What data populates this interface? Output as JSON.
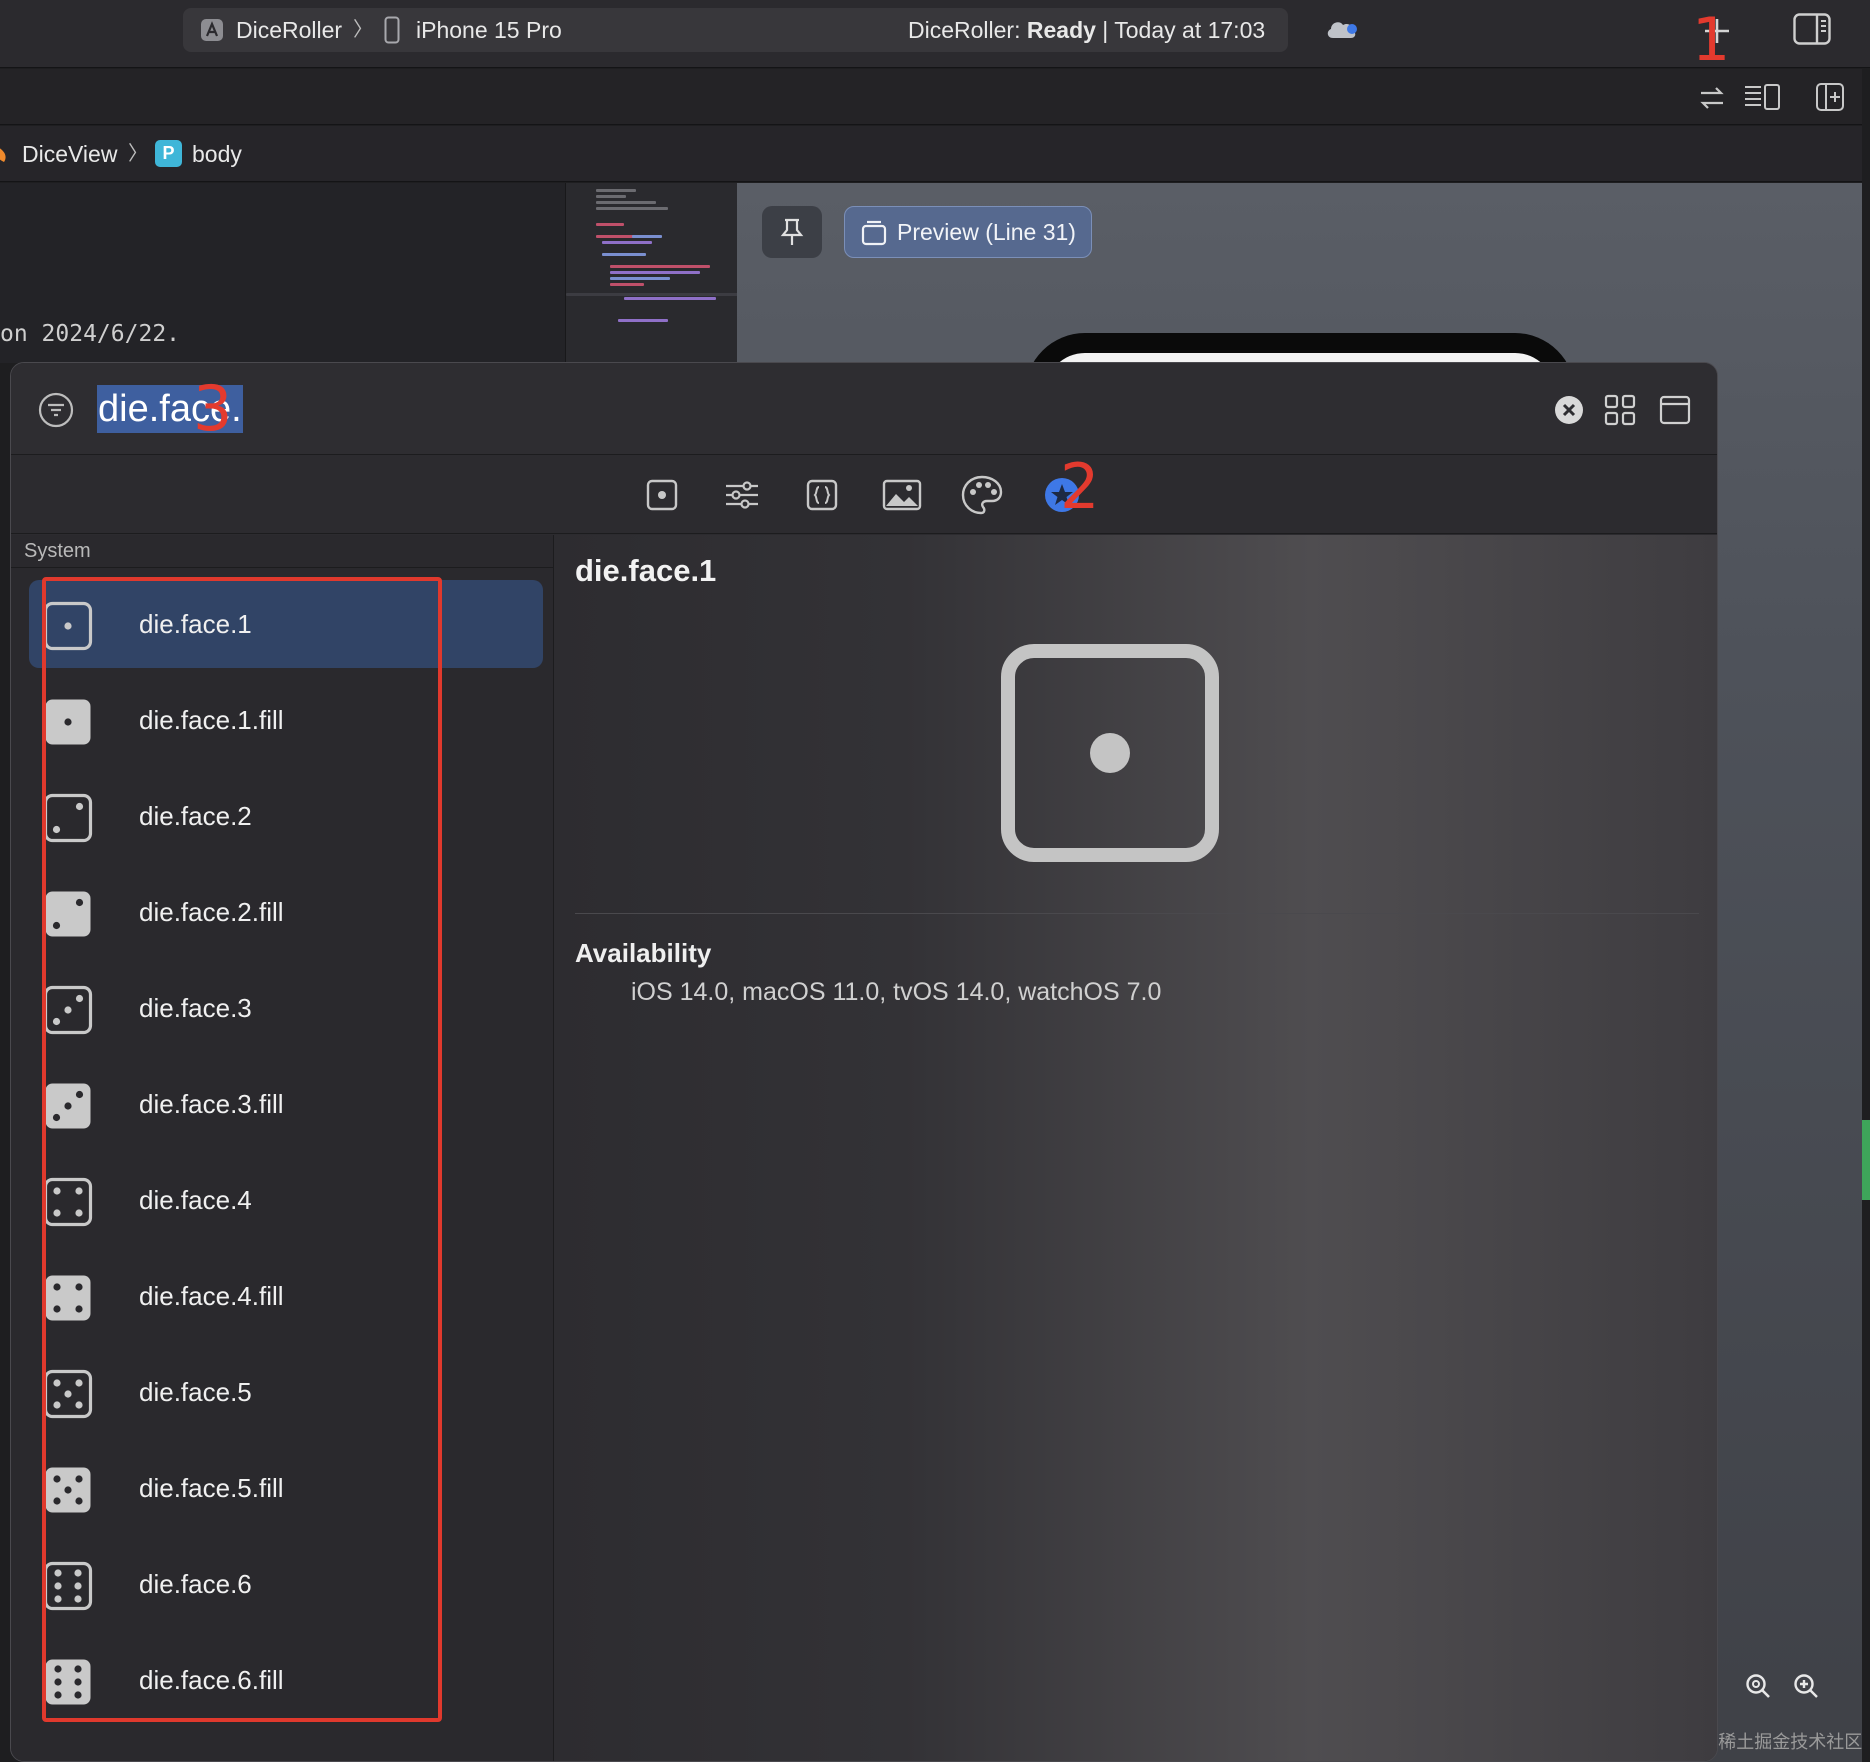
{
  "toolbar": {
    "project": "DiceRoller",
    "device": "iPhone 15 Pro",
    "status_prefix": "DiceRoller: ",
    "status_state": "Ready",
    "status_suffix": " | Today at 17:03",
    "icons": [
      "xcode-project-icon",
      "iphone-icon",
      "cloud-icon",
      "add-library-icon",
      "inspector-toggle-icon"
    ]
  },
  "editor": {
    "icons": [
      "switch-editor-icon",
      "editor-options-icon",
      "add-editor-icon"
    ],
    "breadcrumb": {
      "file": "DiceView",
      "badge": "P",
      "symbol": "body"
    },
    "code_line": "on 2024/6/22."
  },
  "preview": {
    "button_label": "Preview (Line 31)",
    "zoom_icons": [
      "zoom-out-icon",
      "zoom-in-icon"
    ]
  },
  "library": {
    "search_value": "die.face.",
    "header_icons": [
      "filter-icon",
      "clear-search-icon",
      "grid-view-icon",
      "detail-view-icon"
    ],
    "categories": [
      "views",
      "modifiers",
      "snippets",
      "media",
      "colors",
      "symbols"
    ],
    "selected_category": "symbols",
    "section": "System",
    "symbols": [
      {
        "name": "die.face.1",
        "pips": 1,
        "fill": false
      },
      {
        "name": "die.face.1.fill",
        "pips": 1,
        "fill": true
      },
      {
        "name": "die.face.2",
        "pips": 2,
        "fill": false
      },
      {
        "name": "die.face.2.fill",
        "pips": 2,
        "fill": true
      },
      {
        "name": "die.face.3",
        "pips": 3,
        "fill": false
      },
      {
        "name": "die.face.3.fill",
        "pips": 3,
        "fill": true
      },
      {
        "name": "die.face.4",
        "pips": 4,
        "fill": false
      },
      {
        "name": "die.face.4.fill",
        "pips": 4,
        "fill": true
      },
      {
        "name": "die.face.5",
        "pips": 5,
        "fill": false
      },
      {
        "name": "die.face.5.fill",
        "pips": 5,
        "fill": true
      },
      {
        "name": "die.face.6",
        "pips": 6,
        "fill": false
      },
      {
        "name": "die.face.6.fill",
        "pips": 6,
        "fill": true
      }
    ],
    "selected_index": 0,
    "detail": {
      "title": "die.face.1",
      "availability_label": "Availability",
      "availability": "iOS 14.0, macOS 11.0, tvOS 14.0, watchOS 7.0"
    }
  },
  "annotations": {
    "numbers": [
      "1",
      "2",
      "3"
    ],
    "color": "#e33a2e"
  },
  "watermark": "@稀土掘金技术社区",
  "colors": {
    "selection": "#314466",
    "accent_blue": "#3e78e6",
    "search_highlight": "#3e5f9f"
  }
}
